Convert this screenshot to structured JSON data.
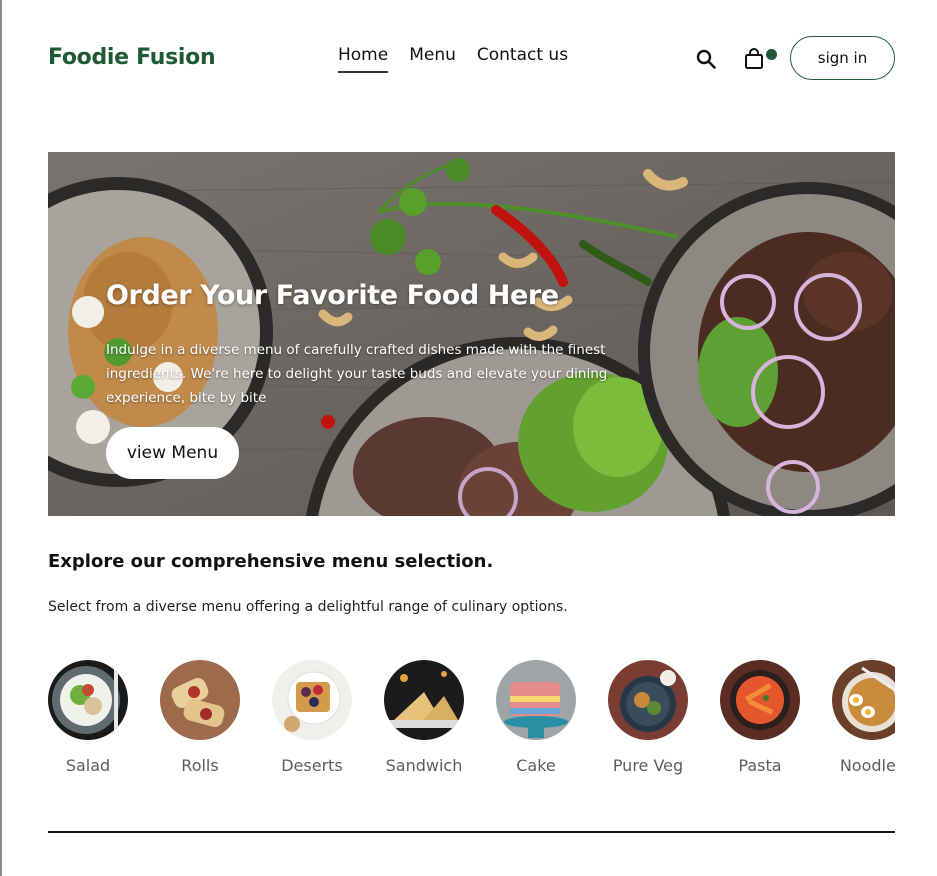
{
  "header": {
    "logo": "Foodie Fusion",
    "nav": [
      {
        "label": "Home",
        "active": true
      },
      {
        "label": "Menu",
        "active": false
      },
      {
        "label": "Contact us",
        "active": false
      }
    ],
    "search_icon": "search-icon",
    "cart_icon": "shopping-bag-icon",
    "cart_indicator_color": "#1f5a36",
    "signin_label": "sign in"
  },
  "hero": {
    "title": "Order Your Favorite Food Here",
    "text": "Indulge in a diverse menu of carefully crafted dishes made with the finest ingredients. We're here to delight your taste buds and elevate your dining experience, bite by bite",
    "button_label": "view Menu"
  },
  "explore": {
    "title": "Explore our comprehensive menu selection.",
    "subtitle": "Select from a diverse menu offering a delightful range of culinary options.",
    "categories": [
      {
        "label": "Salad"
      },
      {
        "label": "Rolls"
      },
      {
        "label": "Deserts"
      },
      {
        "label": "Sandwich"
      },
      {
        "label": "Cake"
      },
      {
        "label": "Pure Veg"
      },
      {
        "label": "Pasta"
      },
      {
        "label": "Noodles"
      }
    ]
  },
  "colors": {
    "brand": "#1f5a36",
    "text": "#111111",
    "muted": "#5d5d5d"
  }
}
